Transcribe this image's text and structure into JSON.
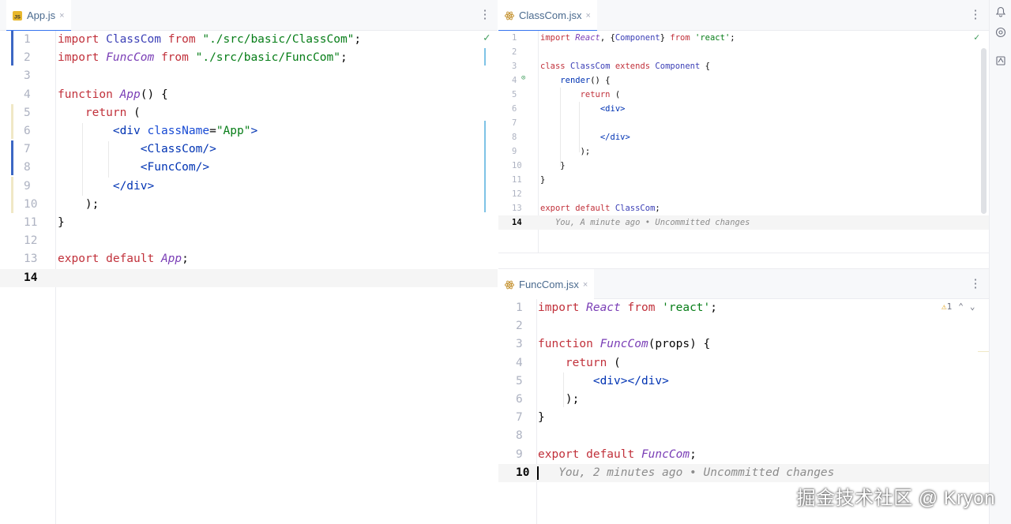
{
  "left": {
    "tab": {
      "label": "App.js",
      "close": "×",
      "icon": "js-file-icon",
      "icon_text": "JS"
    },
    "lines": [
      {
        "n": "1",
        "parts": [
          [
            "kw",
            "import "
          ],
          [
            "cls",
            "ClassCom "
          ],
          [
            "kw",
            "from "
          ],
          [
            "str",
            "\"./src/basic/ClassCom\""
          ],
          [
            "plain",
            ";"
          ]
        ]
      },
      {
        "n": "2",
        "parts": [
          [
            "kw",
            "import "
          ],
          [
            "fn",
            "FuncCom "
          ],
          [
            "kw",
            "from "
          ],
          [
            "str",
            "\"./src/basic/FuncCom\""
          ],
          [
            "plain",
            ";"
          ]
        ]
      },
      {
        "n": "3",
        "parts": []
      },
      {
        "n": "4",
        "parts": [
          [
            "kw",
            "function "
          ],
          [
            "fn",
            "App"
          ],
          [
            "plain",
            "() {"
          ]
        ]
      },
      {
        "n": "5",
        "parts": [
          [
            "plain",
            "    "
          ],
          [
            "kw",
            "return "
          ],
          [
            "plain",
            "("
          ]
        ]
      },
      {
        "n": "6",
        "parts": [
          [
            "plain",
            "        "
          ],
          [
            "tag",
            "<div "
          ],
          [
            "attr",
            "className"
          ],
          [
            "plain",
            "="
          ],
          [
            "str",
            "\"App\""
          ],
          [
            "tag",
            ">"
          ]
        ]
      },
      {
        "n": "7",
        "parts": [
          [
            "plain",
            "            "
          ],
          [
            "tag",
            "<ClassCom/>"
          ]
        ]
      },
      {
        "n": "8",
        "parts": [
          [
            "plain",
            "            "
          ],
          [
            "tag",
            "<FuncCom/>"
          ]
        ]
      },
      {
        "n": "9",
        "parts": [
          [
            "plain",
            "        "
          ],
          [
            "tag",
            "</div>"
          ]
        ]
      },
      {
        "n": "10",
        "parts": [
          [
            "plain",
            "    );"
          ]
        ]
      },
      {
        "n": "11",
        "parts": [
          [
            "plain",
            "}"
          ]
        ]
      },
      {
        "n": "12",
        "parts": []
      },
      {
        "n": "13",
        "parts": [
          [
            "kw",
            "export default "
          ],
          [
            "fn",
            "App"
          ],
          [
            "plain",
            ";"
          ]
        ]
      },
      {
        "n": "14",
        "parts": []
      }
    ]
  },
  "topright": {
    "tab": {
      "label": "ClassCom.jsx",
      "close": "×",
      "icon": "react-file-icon"
    },
    "lines": [
      {
        "n": "1",
        "parts": [
          [
            "kw",
            "import "
          ],
          [
            "fn",
            "React"
          ],
          [
            "plain",
            ", {"
          ],
          [
            "cls",
            "Component"
          ],
          [
            "plain",
            "} "
          ],
          [
            "kw",
            "from "
          ],
          [
            "str",
            "'react'"
          ],
          [
            "plain",
            ";"
          ]
        ]
      },
      {
        "n": "2",
        "parts": []
      },
      {
        "n": "3",
        "parts": [
          [
            "kw",
            "class "
          ],
          [
            "cls",
            "ClassCom "
          ],
          [
            "kw",
            "extends "
          ],
          [
            "cls",
            "Component "
          ],
          [
            "plain",
            "{"
          ]
        ]
      },
      {
        "n": "4",
        "parts": [
          [
            "plain",
            "    "
          ],
          [
            "kw2",
            "render"
          ],
          [
            "plain",
            "() {"
          ]
        ]
      },
      {
        "n": "5",
        "parts": [
          [
            "plain",
            "        "
          ],
          [
            "kw",
            "return "
          ],
          [
            "plain",
            "("
          ]
        ]
      },
      {
        "n": "6",
        "parts": [
          [
            "plain",
            "            "
          ],
          [
            "tag",
            "<div>"
          ]
        ]
      },
      {
        "n": "7",
        "parts": []
      },
      {
        "n": "8",
        "parts": [
          [
            "plain",
            "            "
          ],
          [
            "tag",
            "</div>"
          ]
        ]
      },
      {
        "n": "9",
        "parts": [
          [
            "plain",
            "        );"
          ]
        ]
      },
      {
        "n": "10",
        "parts": [
          [
            "plain",
            "    }"
          ]
        ]
      },
      {
        "n": "11",
        "parts": [
          [
            "plain",
            "}"
          ]
        ]
      },
      {
        "n": "12",
        "parts": []
      },
      {
        "n": "13",
        "parts": [
          [
            "kw",
            "export default "
          ],
          [
            "cls",
            "ClassCom"
          ],
          [
            "plain",
            ";"
          ]
        ]
      },
      {
        "n": "14",
        "parts": [
          [
            "inlay",
            "   You, A minute ago • Uncommitted changes"
          ]
        ]
      }
    ]
  },
  "bottomright": {
    "tab": {
      "label": "FuncCom.jsx",
      "close": "×",
      "icon": "react-file-icon"
    },
    "warning_count": "1",
    "lines": [
      {
        "n": "1",
        "parts": [
          [
            "kw",
            "import "
          ],
          [
            "fn",
            "React "
          ],
          [
            "kw",
            "from "
          ],
          [
            "str",
            "'react'"
          ],
          [
            "plain",
            ";"
          ]
        ]
      },
      {
        "n": "2",
        "parts": []
      },
      {
        "n": "3",
        "parts": [
          [
            "kw",
            "function "
          ],
          [
            "fn",
            "FuncCom"
          ],
          [
            "plain",
            "(props) {"
          ]
        ]
      },
      {
        "n": "4",
        "parts": [
          [
            "plain",
            "    "
          ],
          [
            "kw",
            "return "
          ],
          [
            "plain",
            "("
          ]
        ]
      },
      {
        "n": "5",
        "parts": [
          [
            "plain",
            "        "
          ],
          [
            "tag",
            "<div></div>"
          ]
        ]
      },
      {
        "n": "6",
        "parts": [
          [
            "plain",
            "    );"
          ]
        ]
      },
      {
        "n": "7",
        "parts": [
          [
            "plain",
            "}"
          ]
        ]
      },
      {
        "n": "8",
        "parts": []
      },
      {
        "n": "9",
        "parts": [
          [
            "kw",
            "export default "
          ],
          [
            "fn",
            "FuncCom"
          ],
          [
            "plain",
            ";"
          ]
        ]
      },
      {
        "n": "10",
        "parts": [
          [
            "inlay",
            "   You, 2 minutes ago • Uncommitted changes"
          ]
        ]
      }
    ]
  },
  "watermark": "掘金技术社区 @ Kryon"
}
